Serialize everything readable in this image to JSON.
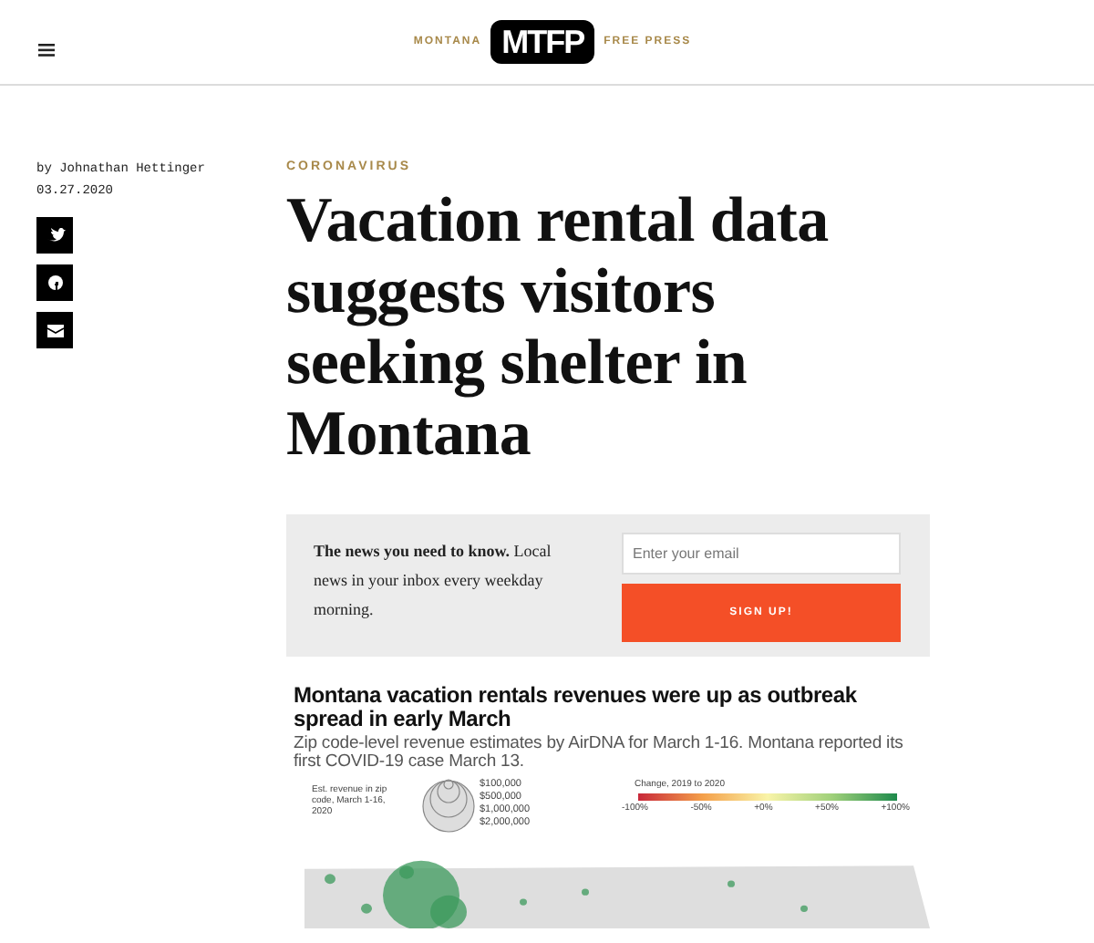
{
  "header": {
    "logo_left": "MONTANA",
    "logo_mark": "MTFP",
    "logo_right": "FREE PRESS"
  },
  "article": {
    "byline": "by Johnathan Hettinger",
    "date": "03.27.2020",
    "share": [
      {
        "kind": "twitter"
      },
      {
        "kind": "facebook"
      },
      {
        "kind": "email"
      }
    ],
    "category": "CORONAVIRUS",
    "headline": "Vacation rental data suggests visitors seeking shelter in Montana"
  },
  "newsletter": {
    "text": "**The news you need to know.** Local news in your inbox every weekday morning.",
    "placeholder": "Enter your email",
    "button": "SIGN UP!"
  },
  "graphic": {
    "title": "Montana vacation rentals revenues were up as outbreak spread in early March",
    "subtitle": "Zip code-level revenue estimates by AirDNA for March 1-16. Montana reported its first COVID-19 case March 13.",
    "size_legend": {
      "label": "Est. revenue in zip code, March 1-16, 2020",
      "items": [
        "$100,000",
        "$500,000",
        "$1,000,000",
        "$2,000,000"
      ]
    },
    "color_legend": {
      "title": "Change, 2019 to 2020",
      "ticks": [
        "-100%",
        "-50%",
        "+0%",
        "+50%",
        "+100%"
      ]
    }
  }
}
